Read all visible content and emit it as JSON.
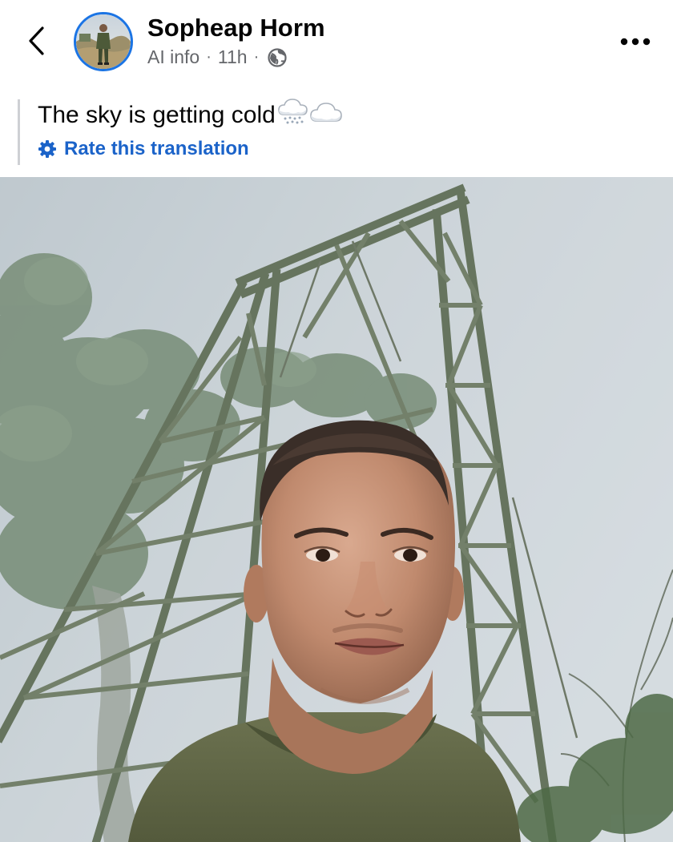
{
  "post": {
    "author_name": "Sopheap Horm",
    "meta_label": "AI info",
    "time": "11h",
    "separator": "·",
    "visibility_icon": "globe-icon",
    "text": "The sky is getting cold",
    "text_emojis": [
      "snow-cloud-icon",
      "cloud-icon"
    ],
    "rate_translation_label": "Rate this translation",
    "rate_translation_icon": "gear-icon"
  },
  "header": {
    "back_icon": "chevron-left-icon",
    "more_icon": "more-options-icon"
  },
  "photo": {
    "subject": "selfie-photo"
  },
  "colors": {
    "link_blue": "#1b63c9",
    "avatar_ring": "#1b74e4",
    "meta_gray": "#65676b",
    "divider": "#ced0d4"
  }
}
